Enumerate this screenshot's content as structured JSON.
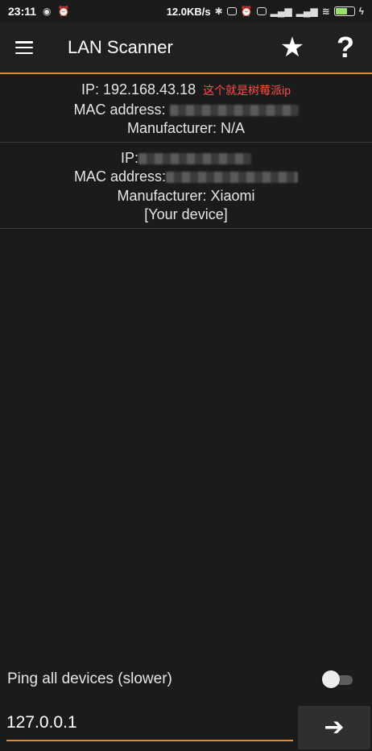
{
  "status_bar": {
    "time": "23:11",
    "net_speed": "12.0KB/s",
    "left_icons": [
      "notification-icon",
      "alarm-icon"
    ],
    "right_icons": [
      "bluetooth-icon",
      "vibrate-icon",
      "alarm-icon",
      "hd-icon",
      "signal-4g-icon",
      "signal-4g-icon",
      "wifi-icon",
      "battery-icon",
      "charging-icon"
    ]
  },
  "app_bar": {
    "title": "LAN Scanner",
    "favorite_icon": "star-icon",
    "help_glyph": "?"
  },
  "devices": [
    {
      "ip_prefix": "IP: ",
      "ip": "192.168.43.18",
      "annotation": "这个就是树莓派ip",
      "mac_label": "MAC address: ",
      "manufacturer_label": "Manufacturer: ",
      "manufacturer": "N/A"
    },
    {
      "ip_prefix": "IP:",
      "mac_label": "MAC address:",
      "manufacturer_label": "Manufacturer: ",
      "manufacturer": "Xiaomi",
      "tag": "[Your device]"
    }
  ],
  "ping": {
    "label": "Ping all devices (slower)",
    "enabled": false
  },
  "input": {
    "value": "127.0.0.1"
  },
  "go_button": {
    "glyph": "➔"
  },
  "colors": {
    "accent": "#e5892b",
    "background": "#1b1b1b",
    "annotation": "#ff4d4d"
  }
}
